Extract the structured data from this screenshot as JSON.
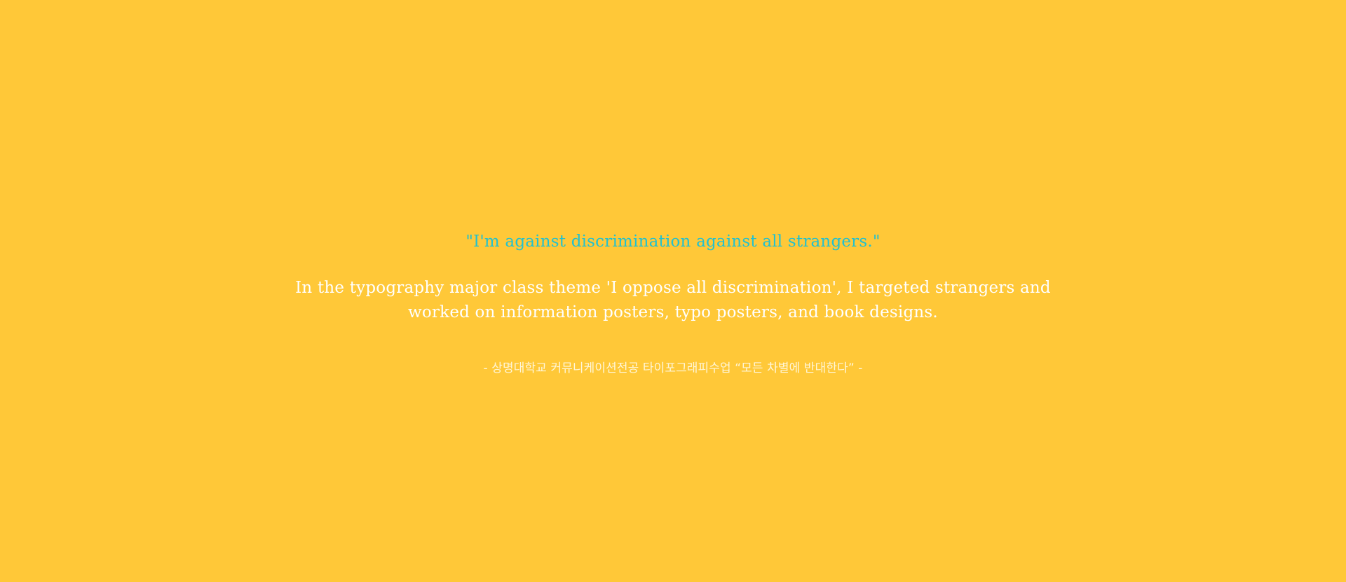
{
  "page": {
    "background_color": "#FFC838",
    "quote_color": "#22C1CF",
    "text_color": "#FFFFFF"
  },
  "quote": "\"I'm against discrimination against all strangers.\"",
  "description": {
    "line1": "In the typography major class theme 'I oppose all discrimination', I targeted strangers and",
    "line2": "worked on information posters, typo posters, and book designs."
  },
  "credit": "- 상명대학교 커뮤니케이션전공 타이포그래피수업 “모든 차별에 반대한다” -"
}
